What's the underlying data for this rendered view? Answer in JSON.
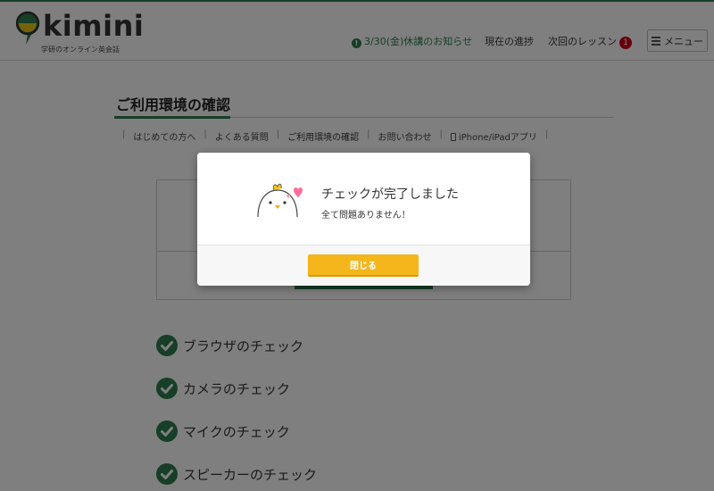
{
  "header": {
    "logo_text": "kimini",
    "logo_tagline": "学研のオンライン英会話",
    "notice": "3/30(金)休講のお知らせ",
    "notice_icon": "exclamation-icon",
    "progress": "現在の進捗",
    "next_lesson": "次回のレッスン",
    "next_lesson_badge": "1",
    "menu": "メニュー",
    "accent_color": "#2e7d4f",
    "badge_color": "#d0021b"
  },
  "page": {
    "title": "ご利用環境の確認",
    "subnav": [
      {
        "label": "はじめての方へ"
      },
      {
        "label": "よくある質問"
      },
      {
        "label": "ご利用環境の確認"
      },
      {
        "label": "お問い合わせ"
      },
      {
        "label": "iPhone/iPadアプリ"
      }
    ],
    "checks": [
      {
        "label": "ブラウザのチェック"
      },
      {
        "label": "カメラのチェック"
      },
      {
        "label": "マイクのチェック"
      },
      {
        "label": "スピーカーのチェック"
      }
    ]
  },
  "modal": {
    "title": "チェックが完了しました",
    "subtitle": "全て問題ありません！",
    "close_label": "閉じる",
    "button_color": "#f5b61b"
  }
}
